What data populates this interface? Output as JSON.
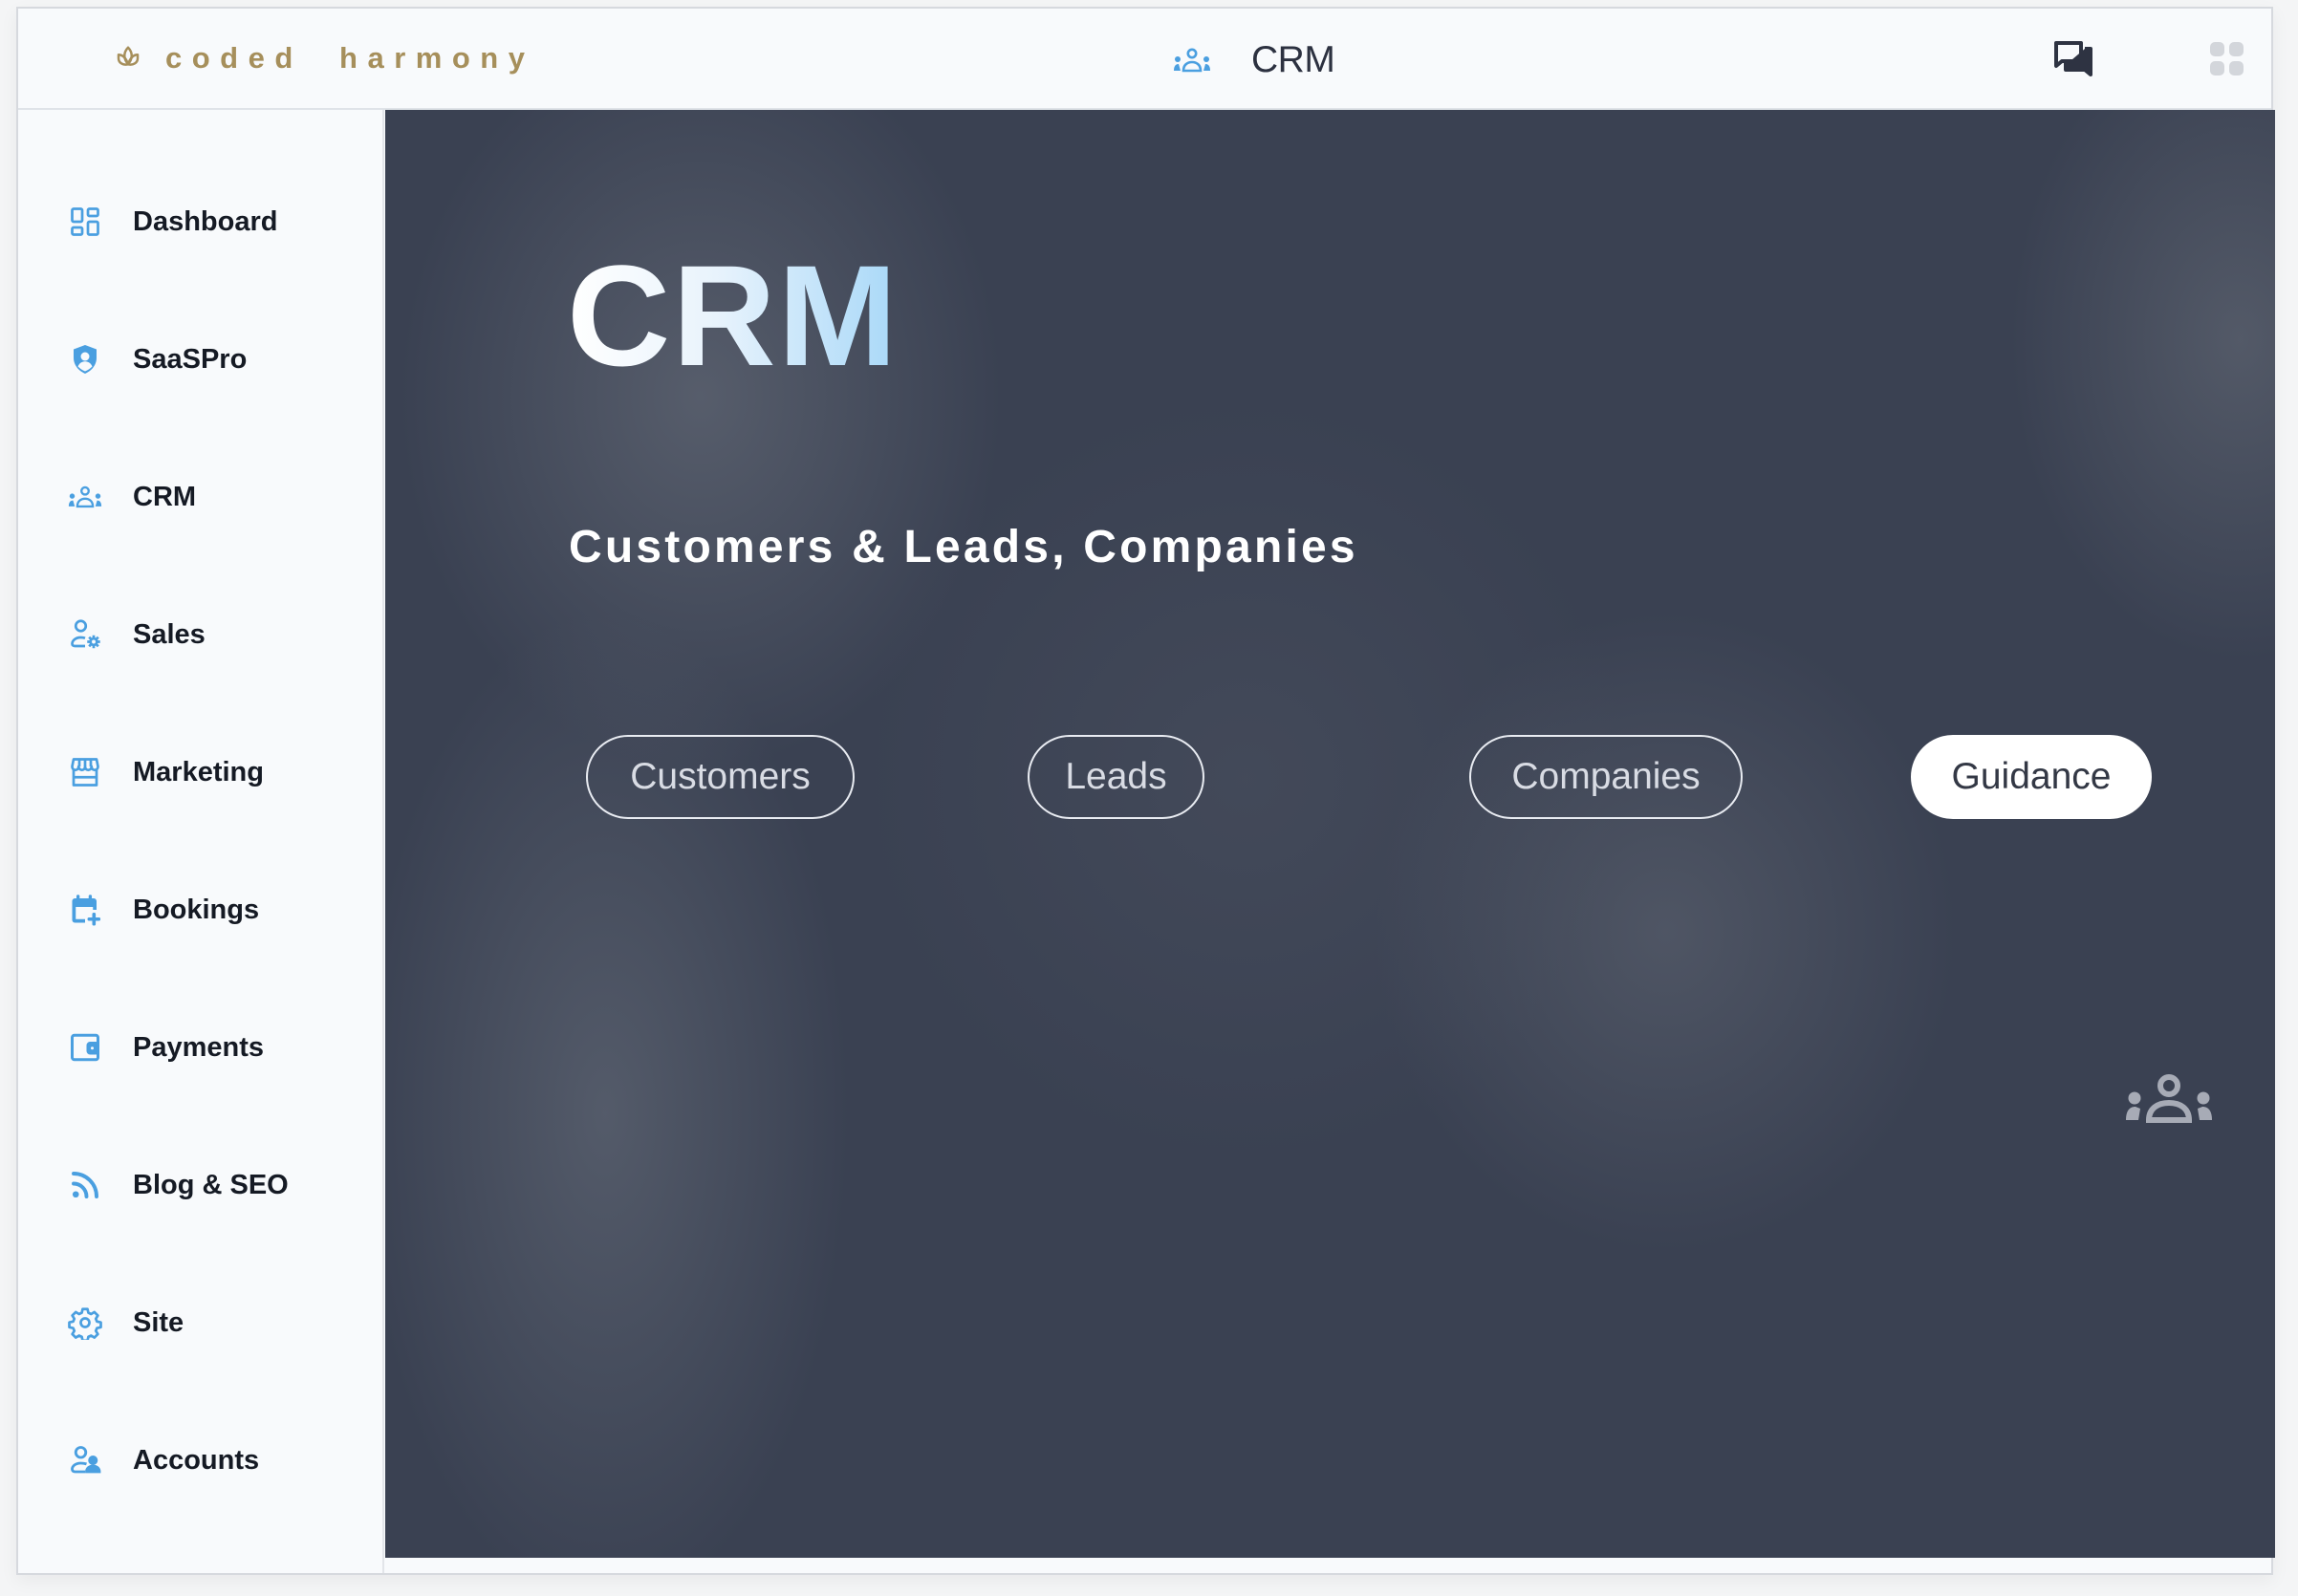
{
  "header": {
    "brand": "coded  harmony",
    "brand_icon": "lotus-icon",
    "section_icon": "users-group-icon",
    "title": "CRM",
    "actions": [
      {
        "name": "chat",
        "icon": "chat-bubbles-icon"
      },
      {
        "name": "apps",
        "icon": "apps-grid-icon"
      }
    ]
  },
  "sidebar": {
    "items": [
      {
        "label": "Dashboard",
        "icon": "dashboard-icon"
      },
      {
        "label": "SaaSPro",
        "icon": "shield-user-icon"
      },
      {
        "label": "CRM",
        "icon": "users-group-icon"
      },
      {
        "label": "Sales",
        "icon": "user-gear-icon"
      },
      {
        "label": "Marketing",
        "icon": "storefront-icon"
      },
      {
        "label": "Bookings",
        "icon": "calendar-plus-icon"
      },
      {
        "label": "Payments",
        "icon": "wallet-icon"
      },
      {
        "label": "Blog & SEO",
        "icon": "rss-icon"
      },
      {
        "label": "Site",
        "icon": "gear-icon"
      },
      {
        "label": "Accounts",
        "icon": "users-icon"
      }
    ]
  },
  "main": {
    "title": "CRM",
    "subtitle": "Customers & Leads, Companies",
    "buttons": [
      {
        "label": "Customers",
        "active": false
      },
      {
        "label": "Leads",
        "active": false
      },
      {
        "label": "Companies",
        "active": false
      },
      {
        "label": "Guidance",
        "active": true
      }
    ],
    "decor_icon": "users-group-icon"
  },
  "colors": {
    "accent": "#4a9fe0",
    "brand": "#a68f5b",
    "panel_bg": "#3a4152",
    "title_gradient_end": "#a8d8f8"
  }
}
